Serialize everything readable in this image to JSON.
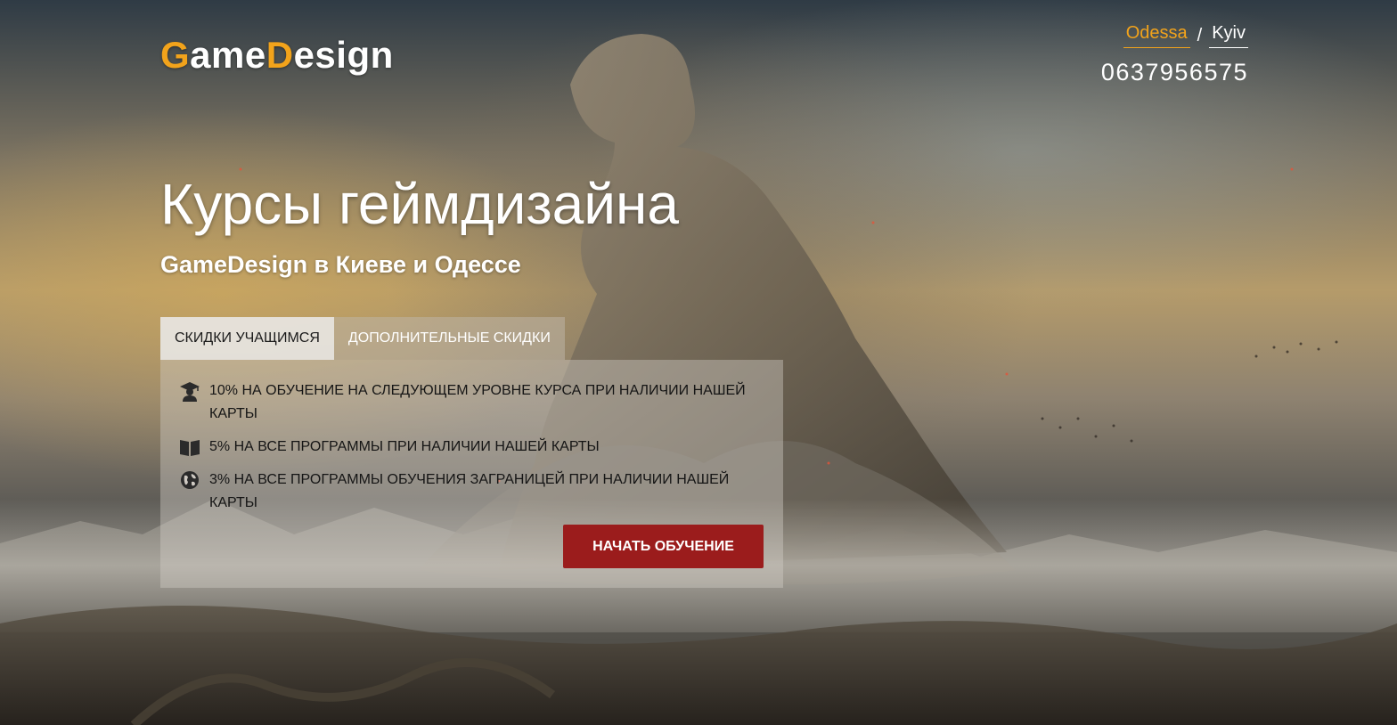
{
  "brand": {
    "logo_part1_accent": "G",
    "logo_part1_rest": "ame",
    "logo_part2_accent": "D",
    "logo_part2_rest": "esign",
    "accent_color": "#f2a31b"
  },
  "header": {
    "cities": [
      {
        "label": "Odessa",
        "active": true
      },
      {
        "label": "Kyiv",
        "active": false
      }
    ],
    "city_separator": "/",
    "phone": "0637956575"
  },
  "hero": {
    "title": "Курсы геймдизайна",
    "subtitle": "GameDesign в Киеве и Одессе"
  },
  "tabs": [
    {
      "label": "СКИДКИ УЧАЩИМСЯ",
      "active": true
    },
    {
      "label": "ДОПОЛНИТЕЛЬНЫЕ СКИДКИ",
      "active": false
    }
  ],
  "offers": [
    {
      "icon": "graduate-icon",
      "text": "10% НА ОБУЧЕНИЕ НА СЛЕДУЮЩЕМ УРОВНЕ КУРСА ПРИ НАЛИЧИИ НАШЕЙ КАРТЫ"
    },
    {
      "icon": "book-icon",
      "text": "5% НА ВСЕ ПРОГРАММЫ ПРИ НАЛИЧИИ НАШЕЙ КАРТЫ"
    },
    {
      "icon": "globe-icon",
      "text": "3% НА ВСЕ ПРОГРАММЫ ОБУЧЕНИЯ ЗАГРАНИЦЕЙ ПРИ НАЛИЧИИ НАШЕЙ КАРТЫ"
    }
  ],
  "cta": {
    "label": "НАЧАТЬ ОБУЧЕНИЕ",
    "color": "#9b1c1c"
  }
}
